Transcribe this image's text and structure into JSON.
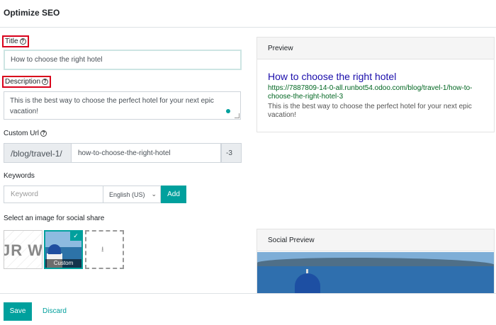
{
  "dialog": {
    "title": "Optimize SEO"
  },
  "title_field": {
    "label": "Title",
    "value": "How to choose the right hotel"
  },
  "description_field": {
    "label": "Description",
    "value": "This is the best way to choose the perfect hotel for your next epic vacation!"
  },
  "custom_url": {
    "label": "Custom Url",
    "prefix": "/blog/travel-1/",
    "value": "how-to-choose-the-right-hotel",
    "suffix": "-3"
  },
  "keywords": {
    "label": "Keywords",
    "placeholder": "Keyword",
    "language": "English (US)",
    "add_label": "Add"
  },
  "social_image": {
    "label": "Select an image for social share",
    "logo_text": "JR W",
    "custom_caption": "Custom",
    "upload_icon": "upload-icon"
  },
  "preview": {
    "heading": "Preview",
    "title": "How to choose the right hotel",
    "url": "https://7887809-14-0-all.runbot54.odoo.com/blog/travel-1/how-to-choose-the-right-hotel-3",
    "description": "This is the best way to choose the perfect hotel for your next epic vacation!"
  },
  "social_preview": {
    "heading": "Social Preview"
  },
  "footer": {
    "save_label": "Save",
    "discard_label": "Discard"
  },
  "colors": {
    "accent": "#00a09d",
    "highlight": "#d9001b",
    "link": "#1a0dab",
    "url": "#006621"
  }
}
